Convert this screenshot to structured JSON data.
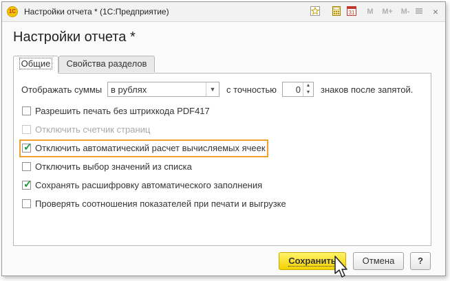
{
  "window": {
    "title": "Настройки отчета * (1С:Предприятие)",
    "logo_text": "1С"
  },
  "titlebar_icons": {
    "favorite": "star-icon",
    "calc": "calculator-icon",
    "calendar": "calendar-icon",
    "calendar_text": "31",
    "m": "M",
    "m_plus": "M+",
    "m_minus": "M-",
    "close": "×"
  },
  "form_title": "Настройки отчета *",
  "tabs": [
    {
      "label": "Общие",
      "active": true
    },
    {
      "label": "Свойства разделов",
      "active": false
    }
  ],
  "sums": {
    "label": "Отображать суммы",
    "value": "в рублях",
    "precision_label": "с точностью",
    "precision_value": "0",
    "precision_suffix": "знаков после запятой."
  },
  "checkboxes": [
    {
      "label": "Разрешить печать без штрихкода PDF417",
      "checked": false,
      "disabled": false
    },
    {
      "label": "Отключить счетчик страниц",
      "checked": false,
      "disabled": true
    },
    {
      "label": "Отключить автоматический расчет вычисляемых ячеек",
      "checked": true,
      "disabled": false
    },
    {
      "label": "Отключить выбор значений из списка",
      "checked": false,
      "disabled": false
    },
    {
      "label": "Сохранять расшифровку автоматического заполнения",
      "checked": true,
      "disabled": false
    },
    {
      "label": "Проверять соотношения показателей при печати и выгрузке",
      "checked": false,
      "disabled": false
    }
  ],
  "buttons": {
    "save": "Сохранить",
    "cancel": "Отмена",
    "help": "?"
  },
  "colors": {
    "highlight": "#f0a030",
    "primary_button": "#f3d100",
    "check": "#1a9a3c"
  }
}
